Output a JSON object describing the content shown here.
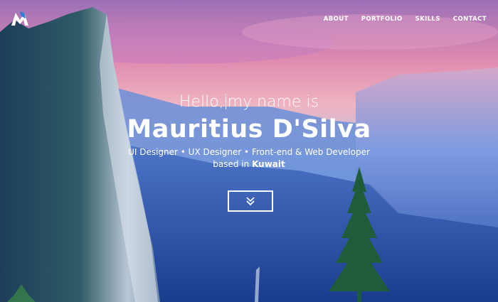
{
  "nav": {
    "items": [
      "ABOUT",
      "PORTFOLIO",
      "SKILLS",
      "CONTACT"
    ]
  },
  "hero": {
    "greeting_before": "Hello,",
    "greeting_after": "my name is",
    "name": "Mauritius D'Silva",
    "role": "UI Designer • UX Designer • Front-end & Web Developer",
    "based_prefix": "based in ",
    "location": "Kuwait"
  },
  "icons": {
    "logo": "logo-mark",
    "scroll": "double-chevron-down-icon"
  },
  "colors": {
    "accent": "#2f7fd6",
    "text": "#ffffff"
  }
}
